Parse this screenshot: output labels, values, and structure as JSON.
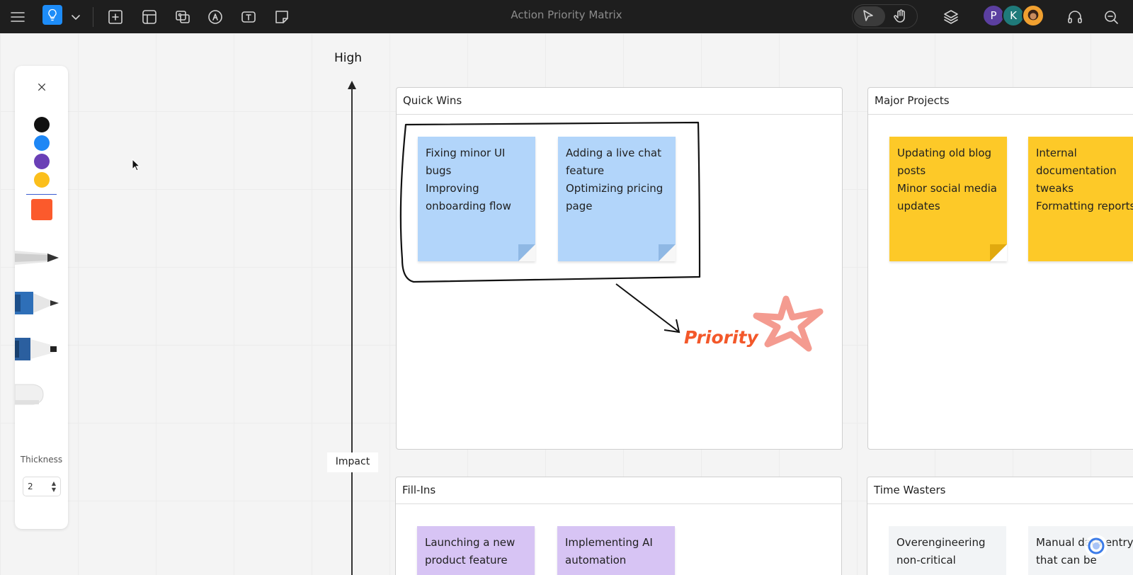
{
  "app": {
    "title": "Action Priority Matrix"
  },
  "toolbar": {
    "icons": [
      "menu-icon",
      "lightbulb-icon",
      "chevron-down-icon",
      "add-frame-icon",
      "template-icon",
      "media-icon",
      "pen-icon",
      "text-icon",
      "sticky-note-icon"
    ],
    "right_icons": [
      "select-cursor-icon",
      "hand-icon",
      "layers-icon",
      "headphones-icon",
      "search-comments-icon"
    ]
  },
  "collaborators": [
    {
      "initial": "P",
      "color": "#5b3fa0"
    },
    {
      "initial": "K",
      "color": "#1f7a7a"
    },
    {
      "initial": "",
      "color": "#f0a030"
    }
  ],
  "draw_panel": {
    "colors": [
      "#111111",
      "#1e87f5",
      "#6a3fb6",
      "#fbbf1c"
    ],
    "selected_color": "#fb5a2c",
    "thickness_label": "Thickness",
    "thickness_value": "2"
  },
  "axis": {
    "top_label": "High",
    "mid_label": "Impact"
  },
  "quadrants": {
    "quick_wins": {
      "title": "Quick Wins",
      "notes": [
        {
          "lines": [
            "Fixing minor UI",
            "bugs",
            "Improving",
            "onboarding flow"
          ]
        },
        {
          "lines": [
            "Adding a live chat",
            "feature",
            "Optimizing pricing",
            "page"
          ]
        }
      ],
      "annotation": "Priority"
    },
    "major_projects": {
      "title": "Major Projects",
      "notes": [
        {
          "lines": [
            "Updating old blog",
            "posts",
            "Minor social media",
            "updates"
          ]
        },
        {
          "lines": [
            "Internal",
            "documentation",
            "tweaks",
            "Formatting reports"
          ]
        }
      ]
    },
    "fill_ins": {
      "title": "Fill-Ins",
      "notes": [
        {
          "lines": [
            "Launching a new",
            "product feature"
          ]
        },
        {
          "lines": [
            "Implementing AI",
            "automation"
          ]
        }
      ]
    },
    "time_wasters": {
      "title": "Time Wasters",
      "notes": [
        {
          "lines": [
            "Overengineering",
            "non-critical"
          ]
        },
        {
          "lines": [
            "Manual data entry",
            "that can be"
          ]
        }
      ]
    }
  }
}
